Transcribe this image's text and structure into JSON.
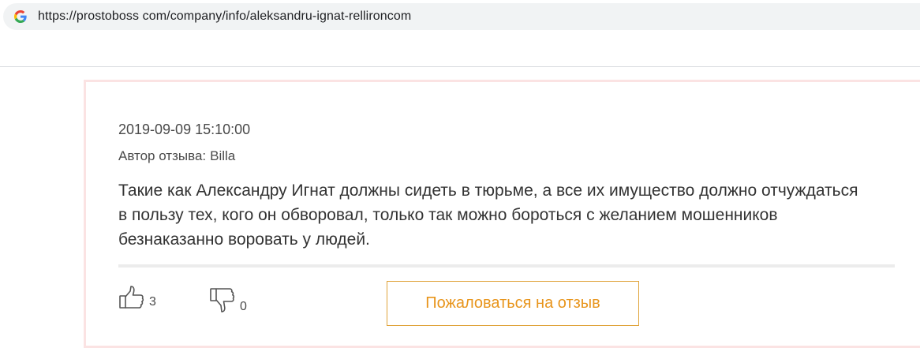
{
  "browser": {
    "url": "https://prostoboss com/company/info/aleksandru-ignat-rellironcom",
    "site_icon": "google-g-icon"
  },
  "review": {
    "date": "2019-09-09 15:10:00",
    "author_label": "Автор отзыва:",
    "author_name": "Billa",
    "text": "Такие как Александру Игнат должны сидеть в тюрьме, а все их имущество должно отчуждаться в пользу тех, кого он обворовал, только так можно бороться с желанием мошенников безнаказанно воровать у людей.",
    "likes": "3",
    "dislikes": "0",
    "complaint_label": "Пожаловаться на отзыв",
    "icons": {
      "like": "thumbs-up-icon",
      "dislike": "thumbs-down-icon"
    },
    "colors": {
      "card_border": "#fbe3e3",
      "accent": "#e8951c"
    }
  }
}
